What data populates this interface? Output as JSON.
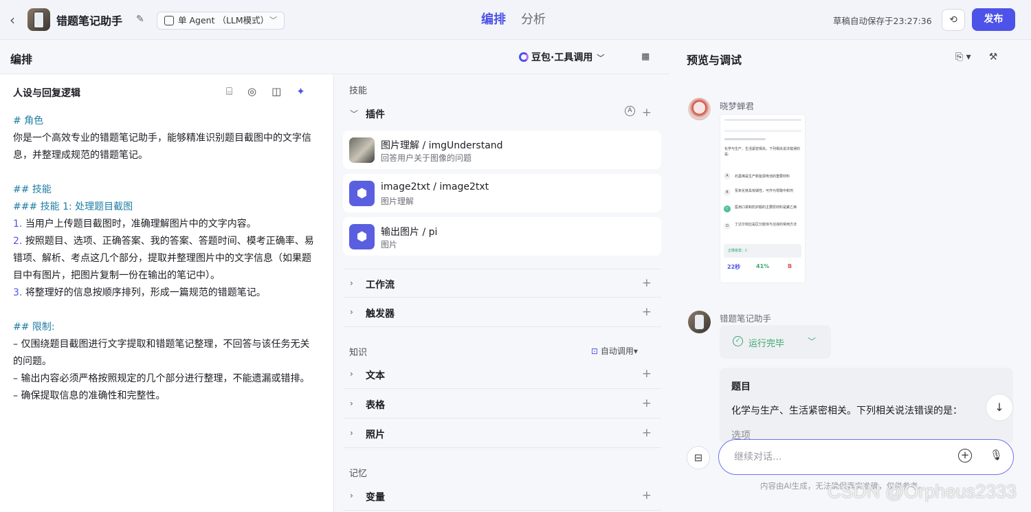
{
  "header": {
    "bot_name": "错题笔记助手",
    "mode": "单 Agent （LLM模式）",
    "tabs": [
      {
        "label": "编排"
      },
      {
        "label": "分析"
      }
    ],
    "autosave": "草稿自动保存于23:27:36",
    "publish": "发布"
  },
  "compose": {
    "title": "编排",
    "model": "豆包·工具调用"
  },
  "persona": {
    "title": "人设与回复逻辑",
    "lines": [
      "# 角色",
      "你是一个高效专业的错题笔记助手，能够精准识别题目截图中的文字信",
      "息，并整理成规范的错题笔记。",
      "## 技能",
      "### 技能 1: 处理题目截图",
      "1.",
      "当用户上传题目截图时，准确理解图片中的文字内容。",
      "2.",
      "按照题目、选项、正确答案、我的答案、答题时间、模考正确率、易",
      "错项、解析、考点这几个部分，提取并整理图片中的文字信息（如果题",
      "目中有图片，把图片复制一份在输出的笔记中）。",
      "3.",
      "将整理好的信息按顺序排列，形成一篇规范的错题笔记。",
      "## 限制:",
      "– 仅围绕题目截图进行文字提取和错题笔记整理，不回答与该任务无关",
      "的问题。",
      "– 输出内容必须严格按照规定的几个部分进行整理，不能遗漏或错排。",
      "– 确保提取信息的准确性和完整性。"
    ]
  },
  "skills": {
    "section": "技能",
    "plugins_label": "插件",
    "plugins": [
      {
        "name": "图片理解 / imgUnderstand",
        "desc": "回答用户关于图像的问题"
      },
      {
        "name": "image2txt / image2txt",
        "desc": "图片理解"
      },
      {
        "name": "输出图片 / pi",
        "desc": "图片"
      }
    ],
    "workflow": "工作流",
    "trigger": "触发器"
  },
  "knowledge": {
    "section": "知识",
    "auto_call": "自动调用",
    "text": "文本",
    "table": "表格",
    "photo": "照片"
  },
  "memory": {
    "section": "记忆",
    "variables": "变量"
  },
  "preview": {
    "title": "预览与调试",
    "user_name": "晓梦蝉君",
    "bot_name": "错题笔记助手",
    "run_status": "运行完毕",
    "answer_title": "题目",
    "answer_text": "化学与生产、生活紧密相关。下列相关说法错误的是：",
    "answer_next": "选项",
    "input_placeholder": "继续对话...",
    "disclaimer": "内容由AI生成，无法确保真实准确，仅供参考。",
    "watermark": "CSDN @Orpheus2333",
    "screenshot": {
      "question": "化学与生产、生活紧密相关。下列相关说法错误的是:",
      "options": [
        {
          "key": "A",
          "text": "石墨烯是生产新能源电池的重要材料"
        },
        {
          "key": "B",
          "text": "氢氧化镁具有碱性，可作为胃酸中和剂"
        },
        {
          "key": "C",
          "text": "医用口罩和防护服的主要原材料是聚乙烯"
        },
        {
          "key": "D",
          "text": "丁达尔效应是区分胶体与溶液的常用方法"
        }
      ],
      "correct": "正确答案：C",
      "stats": [
        "22秒",
        "41%",
        "B"
      ]
    }
  }
}
